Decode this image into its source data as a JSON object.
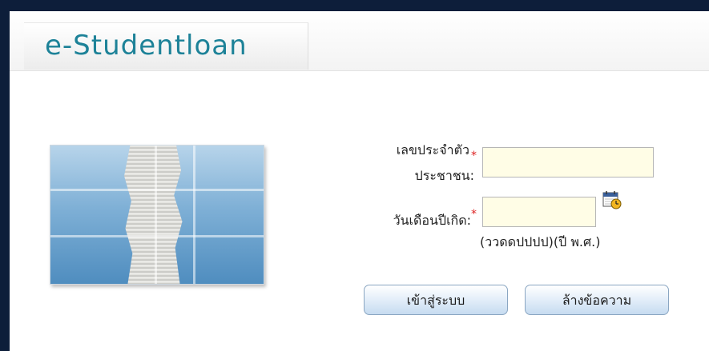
{
  "header": {
    "logo_text": "e-Studentloan"
  },
  "form": {
    "id_label_line1": "เลขประจำตัว",
    "id_label_line2": "ประชาชน:",
    "required_mark": "*",
    "id_value": "",
    "dob_label": "วันเดือนปีเกิด:",
    "dob_value": "",
    "dob_hint": "(ววดดปปปป)(ปี พ.ศ.)"
  },
  "buttons": {
    "login_label": "เข้าสู่ระบบ",
    "clear_label": "ล้างข้อความ"
  },
  "icons": {
    "calendar": "calendar-icon",
    "hero_image": "paper-stack-image"
  },
  "colors": {
    "logo": "#1d8298",
    "required": "#dd2222",
    "field_bg": "#fffde6",
    "page_frame": "#0d1e3a"
  }
}
